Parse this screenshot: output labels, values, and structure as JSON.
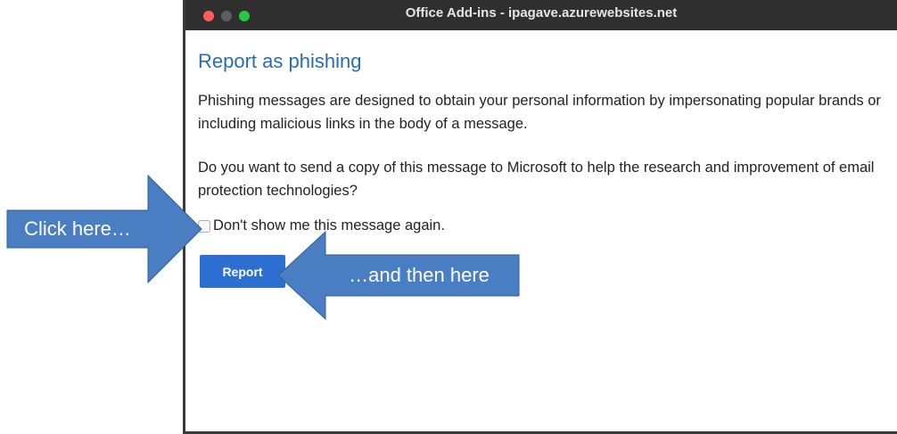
{
  "window": {
    "title": "Office Add-ins - ipagave.azurewebsites.net"
  },
  "dialog": {
    "heading": "Report as phishing",
    "paragraph1": "Phishing messages are designed to obtain your personal information by impersonating popular brands or including malicious links in the body of a message.",
    "paragraph2": "Do you want to send a copy of this message to Microsoft to help the research and improvement of email protection technologies?",
    "checkbox_label": "Don't show me this message again.",
    "checkbox_checked": false,
    "report_label": "Report"
  },
  "annotations": {
    "left_callout": "Click here…",
    "right_callout": "…and then here",
    "color": "#4a7ec2"
  }
}
